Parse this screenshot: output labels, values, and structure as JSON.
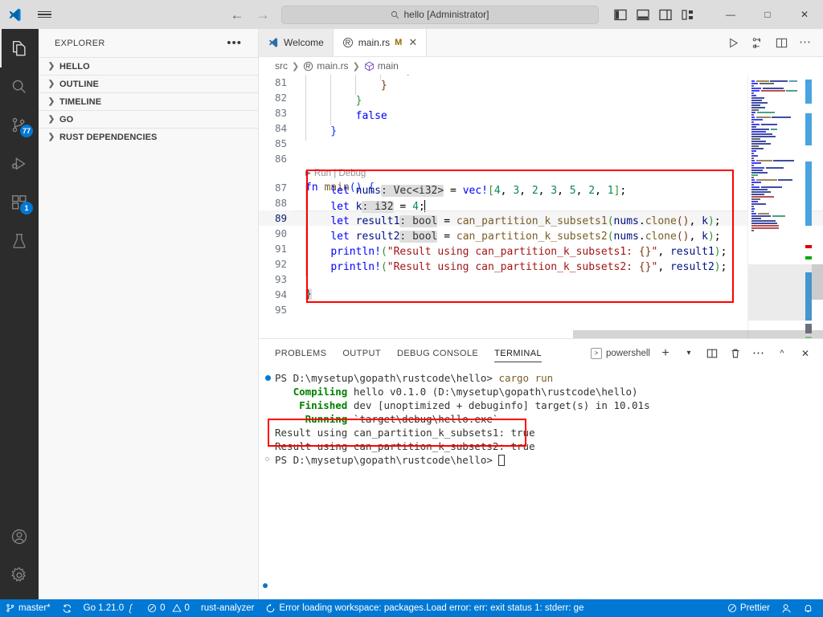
{
  "titlebar": {
    "logo_icon": "vscode-logo-icon",
    "menu_icon": "hamburger-menu-icon",
    "back_icon": "arrow-left-icon",
    "forward_icon": "arrow-right-icon",
    "search_icon": "search-icon",
    "command_center_text": "hello [Administrator]",
    "layout_toggles": [
      {
        "name": "toggle-primary-sidebar-icon",
        "label": "Toggle Primary Side Bar"
      },
      {
        "name": "toggle-panel-icon",
        "label": "Toggle Panel"
      },
      {
        "name": "toggle-secondary-sidebar-icon",
        "label": "Toggle Secondary Side Bar"
      },
      {
        "name": "customize-layout-icon",
        "label": "Customize Layout"
      }
    ],
    "minimize": "—",
    "maximize": "□",
    "close": "✕"
  },
  "activitybar": {
    "items": [
      {
        "name": "explorer",
        "icon": "files-icon",
        "badge": null,
        "active": true
      },
      {
        "name": "search",
        "icon": "search-icon",
        "badge": null,
        "active": false
      },
      {
        "name": "source-control",
        "icon": "source-control-icon",
        "badge": "77",
        "active": false
      },
      {
        "name": "run-and-debug",
        "icon": "run-debug-icon",
        "badge": null,
        "active": false
      },
      {
        "name": "extensions",
        "icon": "extensions-icon",
        "badge": "1",
        "active": false
      },
      {
        "name": "testing",
        "icon": "beaker-icon",
        "badge": null,
        "active": false
      }
    ],
    "bottom_items": [
      {
        "name": "accounts",
        "icon": "account-icon"
      },
      {
        "name": "manage",
        "icon": "gear-icon"
      }
    ]
  },
  "sidebar": {
    "title": "EXPLORER",
    "more_actions": "•••",
    "sections": [
      {
        "label": "HELLO",
        "expanded": false
      },
      {
        "label": "OUTLINE",
        "expanded": false
      },
      {
        "label": "TIMELINE",
        "expanded": false
      },
      {
        "label": "GO",
        "expanded": false
      },
      {
        "label": "RUST DEPENDENCIES",
        "expanded": false
      }
    ]
  },
  "editor": {
    "tabs": [
      {
        "label": "Welcome",
        "icon": "vscode-icon",
        "active": false,
        "dirty": null,
        "closable": false
      },
      {
        "label": "main.rs",
        "icon": "rust-icon",
        "active": true,
        "dirty": "M",
        "closable": true
      }
    ],
    "tab_actions": [
      {
        "name": "run-code-icon",
        "label": "Run Code"
      },
      {
        "name": "run-or-debug-icon",
        "label": "Run or Debug"
      },
      {
        "name": "split-editor-icon",
        "label": "Split Editor Right"
      },
      {
        "name": "more-actions-icon",
        "label": "More Actions"
      }
    ],
    "breadcrumb": [
      {
        "label": "src",
        "icon": null
      },
      {
        "label": "main.rs",
        "icon": "rust-icon"
      },
      {
        "label": "main",
        "icon": "symbol-function-icon"
      }
    ],
    "codelens": "Run | Debug",
    "first_line_number": 81,
    "current_line": 89,
    "lines": [
      {
        "n": 81,
        "indent": 4,
        "text": "                }"
      },
      {
        "n": 82,
        "indent": 3,
        "text": "            }"
      },
      {
        "n": 83,
        "indent": 2,
        "text": "        }"
      },
      {
        "n": 84,
        "indent": 2,
        "text": "        false"
      },
      {
        "n": 85,
        "indent": 1,
        "text": "    }"
      },
      {
        "n": 86,
        "indent": 0,
        "text": ""
      },
      {
        "n": 87,
        "indent": 0,
        "text": "fn main() {"
      },
      {
        "n": 88,
        "indent": 1,
        "text": "    let nums: Vec<i32> = vec![4, 3, 2, 3, 5, 2, 1];"
      },
      {
        "n": 89,
        "indent": 1,
        "text": "    let k: i32 = 4;"
      },
      {
        "n": 90,
        "indent": 1,
        "text": "    let result1: bool = can_partition_k_subsets1(nums.clone(), k);"
      },
      {
        "n": 91,
        "indent": 1,
        "text": "    let result2: bool = can_partition_k_subsets2(nums.clone(), k);"
      },
      {
        "n": 92,
        "indent": 1,
        "text": "    println!(\"Result using can_partition_k_subsets1: {}\", result1);"
      },
      {
        "n": 93,
        "indent": 1,
        "text": "    println!(\"Result using can_partition_k_subsets2: {}\", result2);"
      },
      {
        "n": 94,
        "indent": 0,
        "text": "}"
      },
      {
        "n": 95,
        "indent": 0,
        "text": ""
      }
    ],
    "inlay_hints": [
      "Vec<i32>",
      "i32",
      "bool",
      "bool"
    ],
    "highlight_color": "#ff0000"
  },
  "panel": {
    "tabs": [
      {
        "label": "PROBLEMS",
        "active": false
      },
      {
        "label": "OUTPUT",
        "active": false
      },
      {
        "label": "DEBUG CONSOLE",
        "active": false
      },
      {
        "label": "TERMINAL",
        "active": true
      }
    ],
    "terminal_name": "powershell",
    "actions": [
      {
        "name": "new-terminal-icon",
        "label": "+"
      },
      {
        "name": "terminal-dropdown-icon",
        "label": "⌄"
      },
      {
        "name": "split-terminal-icon",
        "label": "split"
      },
      {
        "name": "kill-terminal-icon",
        "label": "trash"
      },
      {
        "name": "panel-more-actions-icon",
        "label": "•••"
      },
      {
        "name": "maximize-panel-icon",
        "label": "^"
      },
      {
        "name": "close-panel-icon",
        "label": "✕"
      }
    ],
    "terminal_lines": [
      {
        "marker": "success",
        "segments": [
          {
            "t": "PS D:\\mysetup\\gopath\\rustcode\\hello> ",
            "c": "gray"
          },
          {
            "t": "cargo run",
            "c": "yellow"
          }
        ]
      },
      {
        "marker": null,
        "segments": [
          {
            "t": "   Compiling",
            "c": "green"
          },
          {
            "t": " hello v0.1.0 (D:\\mysetup\\gopath\\rustcode\\hello)",
            "c": "gray"
          }
        ]
      },
      {
        "marker": null,
        "segments": [
          {
            "t": "    Finished",
            "c": "green"
          },
          {
            "t": " dev [unoptimized + debuginfo] target(s) in 10.01s",
            "c": "gray"
          }
        ]
      },
      {
        "marker": null,
        "segments": [
          {
            "t": "     Running",
            "c": "green"
          },
          {
            "t": " `target\\debug\\hello.exe`",
            "c": "gray"
          }
        ]
      },
      {
        "marker": null,
        "segments": [
          {
            "t": "Result using can_partition_k_subsets1: true",
            "c": "gray"
          }
        ]
      },
      {
        "marker": null,
        "segments": [
          {
            "t": "Result using can_partition_k_subsets2: true",
            "c": "gray"
          }
        ]
      },
      {
        "marker": "idle",
        "segments": [
          {
            "t": "PS D:\\mysetup\\gopath\\rustcode\\hello> ",
            "c": "gray"
          }
        ]
      }
    ],
    "highlight_color": "#ff0000"
  },
  "statusbar": {
    "background": "#0078d4",
    "left_items": [
      {
        "name": "branch",
        "icon": "source-control-icon",
        "label": "master*"
      },
      {
        "name": "sync",
        "icon": "sync-icon",
        "label": ""
      },
      {
        "name": "go-version",
        "icon": "",
        "label": "Go 1.21.0",
        "suffix_icon": "go-gopher-icon"
      },
      {
        "name": "problems",
        "icon": "error-icon",
        "label": "0",
        "icon2": "warning-icon",
        "label2": "0"
      },
      {
        "name": "rust-analyzer",
        "icon": "",
        "label": "rust-analyzer"
      },
      {
        "name": "workspace-error",
        "icon": "loading-icon",
        "label": "Error loading workspace: packages.Load error: err: exit status 1: stderr: gе"
      }
    ],
    "right_items": [
      {
        "name": "prettier",
        "icon": "prettier-blocked-icon",
        "label": "Prettier"
      },
      {
        "name": "remote-tunnel",
        "icon": "remote-icon",
        "label": ""
      },
      {
        "name": "notifications",
        "icon": "bell-icon",
        "label": ""
      }
    ]
  }
}
